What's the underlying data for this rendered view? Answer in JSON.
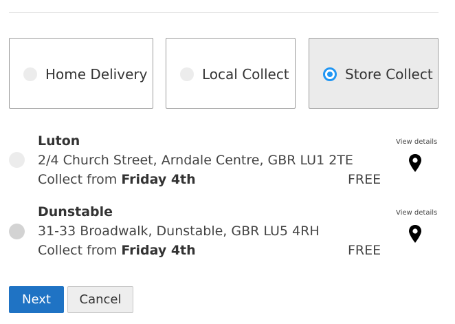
{
  "delivery_options": [
    {
      "label": "Home Delivery",
      "selected": false
    },
    {
      "label": "Local Collect",
      "selected": false
    },
    {
      "label": "Store Collect",
      "selected": true
    }
  ],
  "stores": [
    {
      "name": "Luton",
      "address": "2/4 Church Street, Arndale Centre, GBR LU1 2TE",
      "collect_prefix": "Collect from",
      "collect_day": "Friday 4th",
      "price": "FREE",
      "details_link": "View details",
      "pin_icon": "map-pin-icon"
    },
    {
      "name": "Dunstable",
      "address": "31-33 Broadwalk, Dunstable, GBR LU5 4RH",
      "collect_prefix": "Collect from",
      "collect_day": "Friday 4th",
      "price": "FREE",
      "details_link": "View details",
      "pin_icon": "map-pin-icon"
    }
  ],
  "buttons": {
    "next": "Next",
    "cancel": "Cancel"
  },
  "colors": {
    "accent": "#2196f3",
    "primary_button": "#1f73c4"
  }
}
